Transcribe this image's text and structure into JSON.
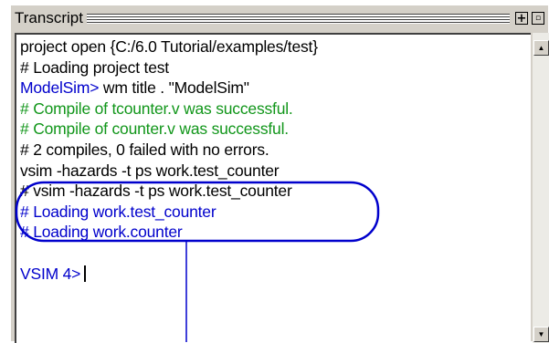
{
  "window": {
    "title": "Transcript",
    "dock_button": "+",
    "float_button": "▫"
  },
  "transcript": {
    "lines": [
      {
        "text": "project open {C:/6.0 Tutorial/examples/test}",
        "color": "black"
      },
      {
        "text": "# Loading project test",
        "color": "black"
      },
      {
        "text": "ModelSim>",
        "after": " wm title . \"ModelSim\"",
        "color": "blue"
      },
      {
        "text": "# Compile of tcounter.v was successful.",
        "color": "green"
      },
      {
        "text": "# Compile of counter.v was successful.",
        "color": "green"
      },
      {
        "text": "# 2 compiles, 0 failed with no errors.",
        "color": "black"
      },
      {
        "text": "vsim -hazards -t ps work.test_counter",
        "color": "black"
      },
      {
        "text": "# vsim -hazards -t ps work.test_counter",
        "color": "black"
      },
      {
        "text": "# Loading work.test_counter",
        "color": "blue"
      },
      {
        "text": "# Loading work.counter",
        "color": "blue"
      },
      {
        "text": "",
        "color": "black"
      },
      {
        "text": "VSIM 4>",
        "color": "blue"
      }
    ]
  },
  "scrollbar": {
    "up_arrow": "▲",
    "down_arrow": "▼"
  },
  "annotation": {
    "color": "#0000cc"
  }
}
